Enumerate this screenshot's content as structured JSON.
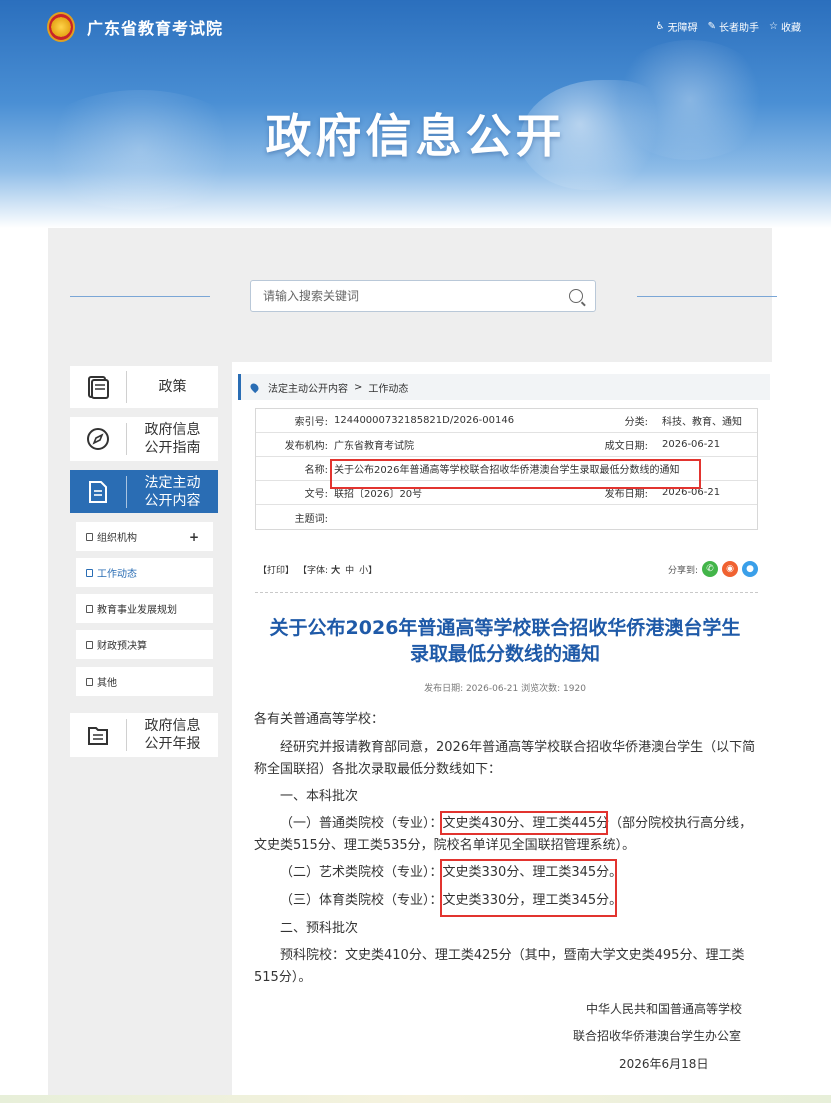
{
  "header": {
    "site_name": "广东省教育考试院",
    "banner_title": "政府信息公开",
    "top_links": [
      "无障碍",
      "长者助手",
      "收藏"
    ],
    "top_link_icons": [
      "accessibility-icon",
      "elder-helper-icon",
      "star-icon"
    ]
  },
  "search": {
    "placeholder": "请输入搜索关键词"
  },
  "sidebar": {
    "cards": [
      {
        "label_line1": "政策",
        "label_line2": "",
        "icon": "policy-book-icon"
      },
      {
        "label_line1": "政府信息",
        "label_line2": "公开指南",
        "icon": "compass-icon"
      },
      {
        "label_line1": "法定主动",
        "label_line2": "公开内容",
        "icon": "document-icon",
        "active": true
      },
      {
        "label_line1": "政府信息",
        "label_line2": "公开年报",
        "icon": "annual-report-icon"
      }
    ],
    "sub_items": [
      {
        "label": "组织机构",
        "plus": "+"
      },
      {
        "label": "工作动态",
        "current": true
      },
      {
        "label": "教育事业发展规划"
      },
      {
        "label": "财政预决算"
      },
      {
        "label": "其他"
      }
    ]
  },
  "breadcrumb": {
    "part1": "法定主动公开内容",
    "separator": ">",
    "part2": "工作动态"
  },
  "meta": {
    "index_key": "索引号:",
    "index_val": "12440000732185821D/2026-00146",
    "cat_key": "分类:",
    "cat_val": "科技、教育、通知",
    "org_key": "发布机构:",
    "org_val": "广东省教育考试院",
    "made_key": "成文日期:",
    "made_val": "2026-06-21",
    "name_key": "名称:",
    "name_val": "关于公布2026年普通高等学校联合招收华侨港澳台学生录取最低分数线的通知",
    "doc_key": "文号:",
    "doc_val": "联招〔2026〕20号",
    "pub_key": "发布日期:",
    "pub_val": "2026-06-21",
    "kw_key": "主题词:",
    "kw_val": ""
  },
  "toolbar": {
    "print": "【打印】",
    "font_label": "【字体:",
    "font_large": "大",
    "font_mid": "中",
    "font_small": "小",
    "font_end": "】",
    "share_label": "分享到:"
  },
  "article": {
    "title_line1": "关于公布2026年普通高等学校联合招收华侨港澳台学生",
    "title_line2": "录取最低分数线的通知",
    "pub_info": "发布日期:  2026-06-21   浏览次数:  1920",
    "greeting": "各有关普通高等学校：",
    "p1": "经研究并报请教育部同意，2026年普通高等学校联合招收华侨港澳台学生（以下简称全国联招）各批次录取最低分数线如下：",
    "s1": "一、本科批次",
    "l1_pre": "（一）普通类院校（专业）：",
    "l1_hl": "文史类430分、理工类445分",
    "l1_post": "（部分院校执行高分线，文史类515分、理工类535分，院校名单详见全国联招管理系统）。",
    "l2_pre": "（二）艺术类院校（专业）：",
    "l2_hl": "文史类330分、理工类345分。",
    "l3_pre": "（三）体育类院校（专业）：",
    "l3_hl": "文史类330分，理工类345分。",
    "s2": "二、预科批次",
    "p2": "预科院校：文史类410分、理工类425分（其中，暨南大学文史类495分、理工类515分）。",
    "sign1": "中华人民共和国普通高等学校",
    "sign2": "联合招收华侨港澳台学生办公室",
    "sign_date": "2026年6月18日"
  }
}
